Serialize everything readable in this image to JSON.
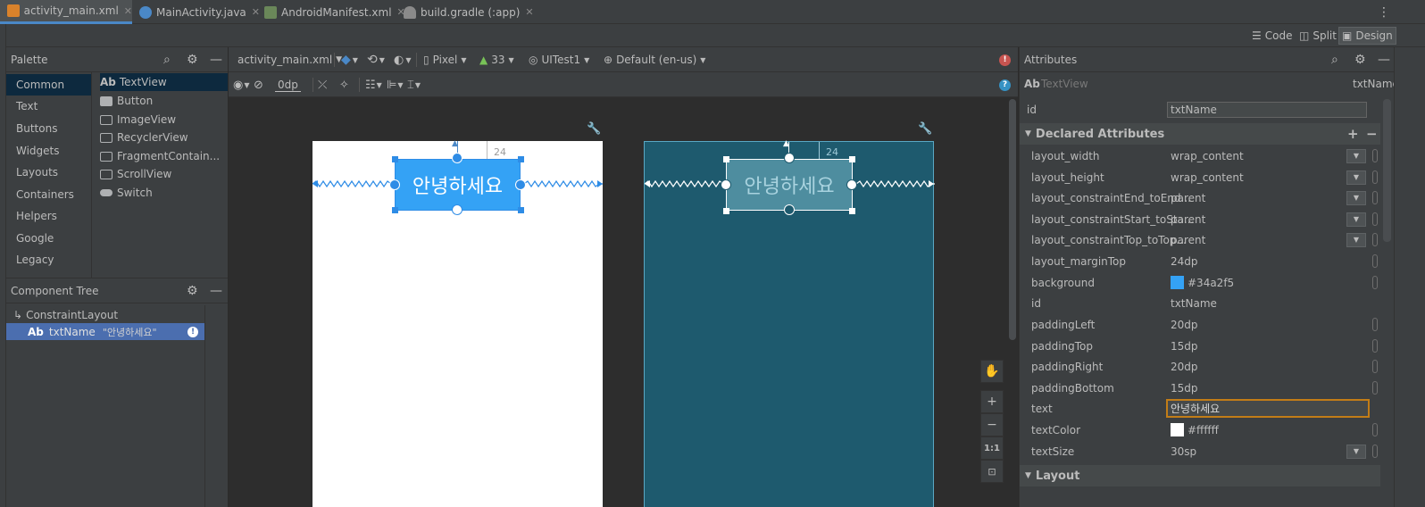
{
  "editor_tabs": [
    {
      "label": "activity_main.xml",
      "icon": "xml-layout-icon",
      "color": "#d9822b"
    },
    {
      "label": "MainActivity.java",
      "icon": "java-class-icon",
      "color": "#4a88c7"
    },
    {
      "label": "AndroidManifest.xml",
      "icon": "manifest-icon",
      "color": "#6a8759"
    },
    {
      "label": "build.gradle (:app)",
      "icon": "gradle-icon",
      "color": "#8a8a8a"
    }
  ],
  "view_modes": {
    "code": "Code",
    "split": "Split",
    "design": "Design"
  },
  "palette": {
    "title": "Palette",
    "categories": [
      "Common",
      "Text",
      "Buttons",
      "Widgets",
      "Layouts",
      "Containers",
      "Helpers",
      "Google",
      "Legacy"
    ],
    "widgets": [
      {
        "prefix": "Ab",
        "label": "TextView"
      },
      {
        "prefix": "",
        "label": "Button"
      },
      {
        "prefix": "",
        "label": "ImageView"
      },
      {
        "prefix": "",
        "label": "RecyclerView"
      },
      {
        "prefix": "",
        "label": "FragmentContain..."
      },
      {
        "prefix": "",
        "label": "ScrollView"
      },
      {
        "prefix": "",
        "label": "Switch"
      }
    ]
  },
  "component_tree": {
    "title": "Component Tree",
    "root": "ConstraintLayout",
    "child_prefix": "Ab",
    "child_name": "txtName",
    "child_text": "\"안녕하세요\""
  },
  "design_toolbar": {
    "file": "activity_main.xml",
    "device": "Pixel",
    "api": "33",
    "theme": "UITest1",
    "locale": "Default (en-us)",
    "margin": "0dp"
  },
  "canvas": {
    "textview_text": "안녕하세요",
    "margin_label": "24",
    "background_color": "#34a2f5",
    "blueprint_color": "#1e5a6e",
    "zoom_fit": "1:1"
  },
  "attributes": {
    "title": "Attributes",
    "widget_prefix": "Ab",
    "widget_type": "TextView",
    "widget_id": "txtName",
    "id_label": "id",
    "id_value": "txtName",
    "declared_title": "Declared Attributes",
    "rows": [
      {
        "name": "layout_width",
        "value": "wrap_content",
        "dropdown": true
      },
      {
        "name": "layout_height",
        "value": "wrap_content",
        "dropdown": true
      },
      {
        "name": "layout_constraintEnd_toEnd...",
        "value": "parent",
        "dropdown": true
      },
      {
        "name": "layout_constraintStart_toSta...",
        "value": "parent",
        "dropdown": true
      },
      {
        "name": "layout_constraintTop_toTop...",
        "value": "parent",
        "dropdown": true
      },
      {
        "name": "layout_marginTop",
        "value": "24dp",
        "dropdown": false
      },
      {
        "name": "background",
        "value": "#34a2f5",
        "dropdown": false,
        "swatch": "#34a2f5"
      },
      {
        "name": "id",
        "value": "txtName",
        "dropdown": false
      },
      {
        "name": "paddingLeft",
        "value": "20dp",
        "dropdown": false
      },
      {
        "name": "paddingTop",
        "value": "15dp",
        "dropdown": false
      },
      {
        "name": "paddingRight",
        "value": "20dp",
        "dropdown": false
      },
      {
        "name": "paddingBottom",
        "value": "15dp",
        "dropdown": false
      },
      {
        "name": "text",
        "value": "안녕하세요",
        "dropdown": false,
        "editing": true
      },
      {
        "name": "textColor",
        "value": "#ffffff",
        "dropdown": false,
        "swatch": "#ffffff"
      },
      {
        "name": "textSize",
        "value": "30sp",
        "dropdown": true
      }
    ],
    "layout_section": "Layout"
  }
}
